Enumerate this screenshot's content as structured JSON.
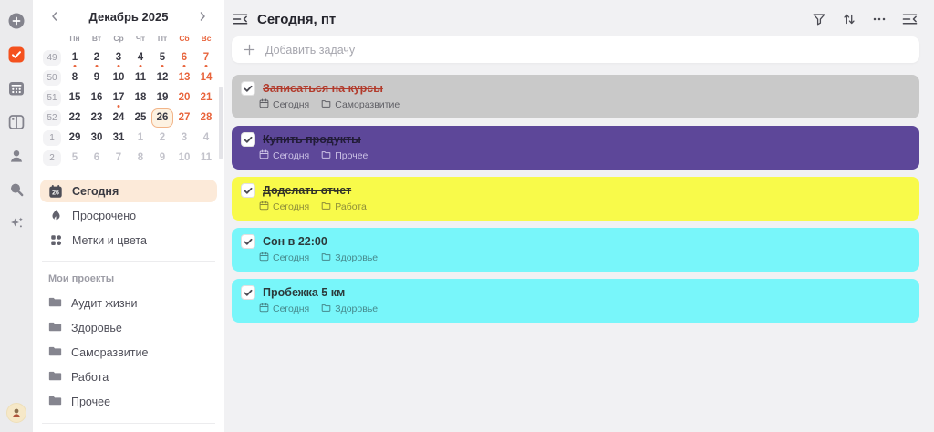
{
  "rail": {
    "icons": [
      {
        "name": "add",
        "active": false
      },
      {
        "name": "tasks",
        "active": true
      },
      {
        "name": "calendar",
        "active": false
      },
      {
        "name": "kanban",
        "active": false
      },
      {
        "name": "contacts",
        "active": false
      },
      {
        "name": "search",
        "active": false
      },
      {
        "name": "sparkles",
        "active": false
      }
    ]
  },
  "sidebar": {
    "calendar": {
      "title": "Декабрь 2025",
      "dow": [
        {
          "label": "Пн"
        },
        {
          "label": "Вт"
        },
        {
          "label": "Ср"
        },
        {
          "label": "Чт"
        },
        {
          "label": "Пт"
        },
        {
          "label": "Сб",
          "weekend": true
        },
        {
          "label": "Вс",
          "weekend": true
        }
      ],
      "weeks": [
        {
          "num": "49",
          "days": [
            {
              "d": "1",
              "dot": true
            },
            {
              "d": "2",
              "dot": true
            },
            {
              "d": "3",
              "dot": true
            },
            {
              "d": "4",
              "dot": true
            },
            {
              "d": "5",
              "dot": true
            },
            {
              "d": "6",
              "dot": true,
              "weekend": true
            },
            {
              "d": "7",
              "dot": true,
              "weekend": true
            }
          ]
        },
        {
          "num": "50",
          "days": [
            {
              "d": "8"
            },
            {
              "d": "9"
            },
            {
              "d": "10"
            },
            {
              "d": "11"
            },
            {
              "d": "12"
            },
            {
              "d": "13",
              "weekend": true
            },
            {
              "d": "14",
              "weekend": true
            }
          ]
        },
        {
          "num": "51",
          "days": [
            {
              "d": "15"
            },
            {
              "d": "16"
            },
            {
              "d": "17",
              "dot": true
            },
            {
              "d": "18"
            },
            {
              "d": "19"
            },
            {
              "d": "20",
              "weekend": true
            },
            {
              "d": "21",
              "weekend": true
            }
          ]
        },
        {
          "num": "52",
          "days": [
            {
              "d": "22"
            },
            {
              "d": "23"
            },
            {
              "d": "24"
            },
            {
              "d": "25"
            },
            {
              "d": "26",
              "selected": true
            },
            {
              "d": "27",
              "weekend": true
            },
            {
              "d": "28",
              "weekend": true
            }
          ]
        },
        {
          "num": "1",
          "days": [
            {
              "d": "29"
            },
            {
              "d": "30"
            },
            {
              "d": "31"
            },
            {
              "d": "1",
              "muted": true
            },
            {
              "d": "2",
              "muted": true
            },
            {
              "d": "3",
              "muted": true
            },
            {
              "d": "4",
              "muted": true
            }
          ]
        },
        {
          "num": "2",
          "days": [
            {
              "d": "5",
              "muted": true
            },
            {
              "d": "6",
              "muted": true
            },
            {
              "d": "7",
              "muted": true
            },
            {
              "d": "8",
              "muted": true
            },
            {
              "d": "9",
              "muted": true
            },
            {
              "d": "10",
              "muted": true
            },
            {
              "d": "11",
              "muted": true
            }
          ]
        }
      ]
    },
    "nav": [
      {
        "label": "Сегодня",
        "icon": "today-calendar",
        "badge": "26",
        "active": true
      },
      {
        "label": "Просрочено",
        "icon": "flame",
        "active": false
      },
      {
        "label": "Метки и цвета",
        "icon": "labels-grid",
        "active": false
      }
    ],
    "projects_title": "Мои проекты",
    "projects": [
      {
        "label": "Аудит жизни"
      },
      {
        "label": "Здоровье"
      },
      {
        "label": "Саморазвитие"
      },
      {
        "label": "Работа"
      },
      {
        "label": "Прочее"
      }
    ]
  },
  "main": {
    "title": "Сегодня, пт",
    "collapse_icon": "collapse-sidebar",
    "toolbar": [
      {
        "name": "filter"
      },
      {
        "name": "sort"
      },
      {
        "name": "more"
      },
      {
        "name": "collapse-panel"
      }
    ],
    "add_task": {
      "placeholder": "Добавить задачу"
    },
    "tasks": [
      {
        "title": "Записаться на курсы",
        "date": "Сегодня",
        "project": "Саморазвитие",
        "bg": "#c9c9c9",
        "title_color": "#b23b2c",
        "meta_color": "#5f5f65",
        "done": true
      },
      {
        "title": "Купить продукты",
        "date": "Сегодня",
        "project": "Прочее",
        "bg": "#5d4799",
        "title_color": "#221c38",
        "meta_color": "#cbc2e5",
        "done": true
      },
      {
        "title": "Доделать отчет",
        "date": "Сегодня",
        "project": "Работа",
        "bg": "#f8fa4a",
        "title_color": "#303028",
        "meta_color": "#8d8d38",
        "done": true
      },
      {
        "title": "Сон в 22:00",
        "date": "Сегодня",
        "project": "Здоровье",
        "bg": "#78f6fa",
        "title_color": "#2b3a3b",
        "meta_color": "#46898c",
        "done": true
      },
      {
        "title": "Пробежка 5 км",
        "date": "Сегодня",
        "project": "Здоровье",
        "bg": "#78f6fa",
        "title_color": "#2b3a3b",
        "meta_color": "#46898c",
        "done": true
      }
    ]
  },
  "colors": {
    "accent_orange": "#f4511e",
    "weekend_orange": "#e8643c",
    "nav_active_bg": "#fcead9",
    "selected_day_border": "#f2b488",
    "selected_day_bg": "#fdf2e2",
    "sidebar_bg": "#ffffff",
    "rail_bg": "#ebebed",
    "main_bg": "#f1f1f3"
  }
}
